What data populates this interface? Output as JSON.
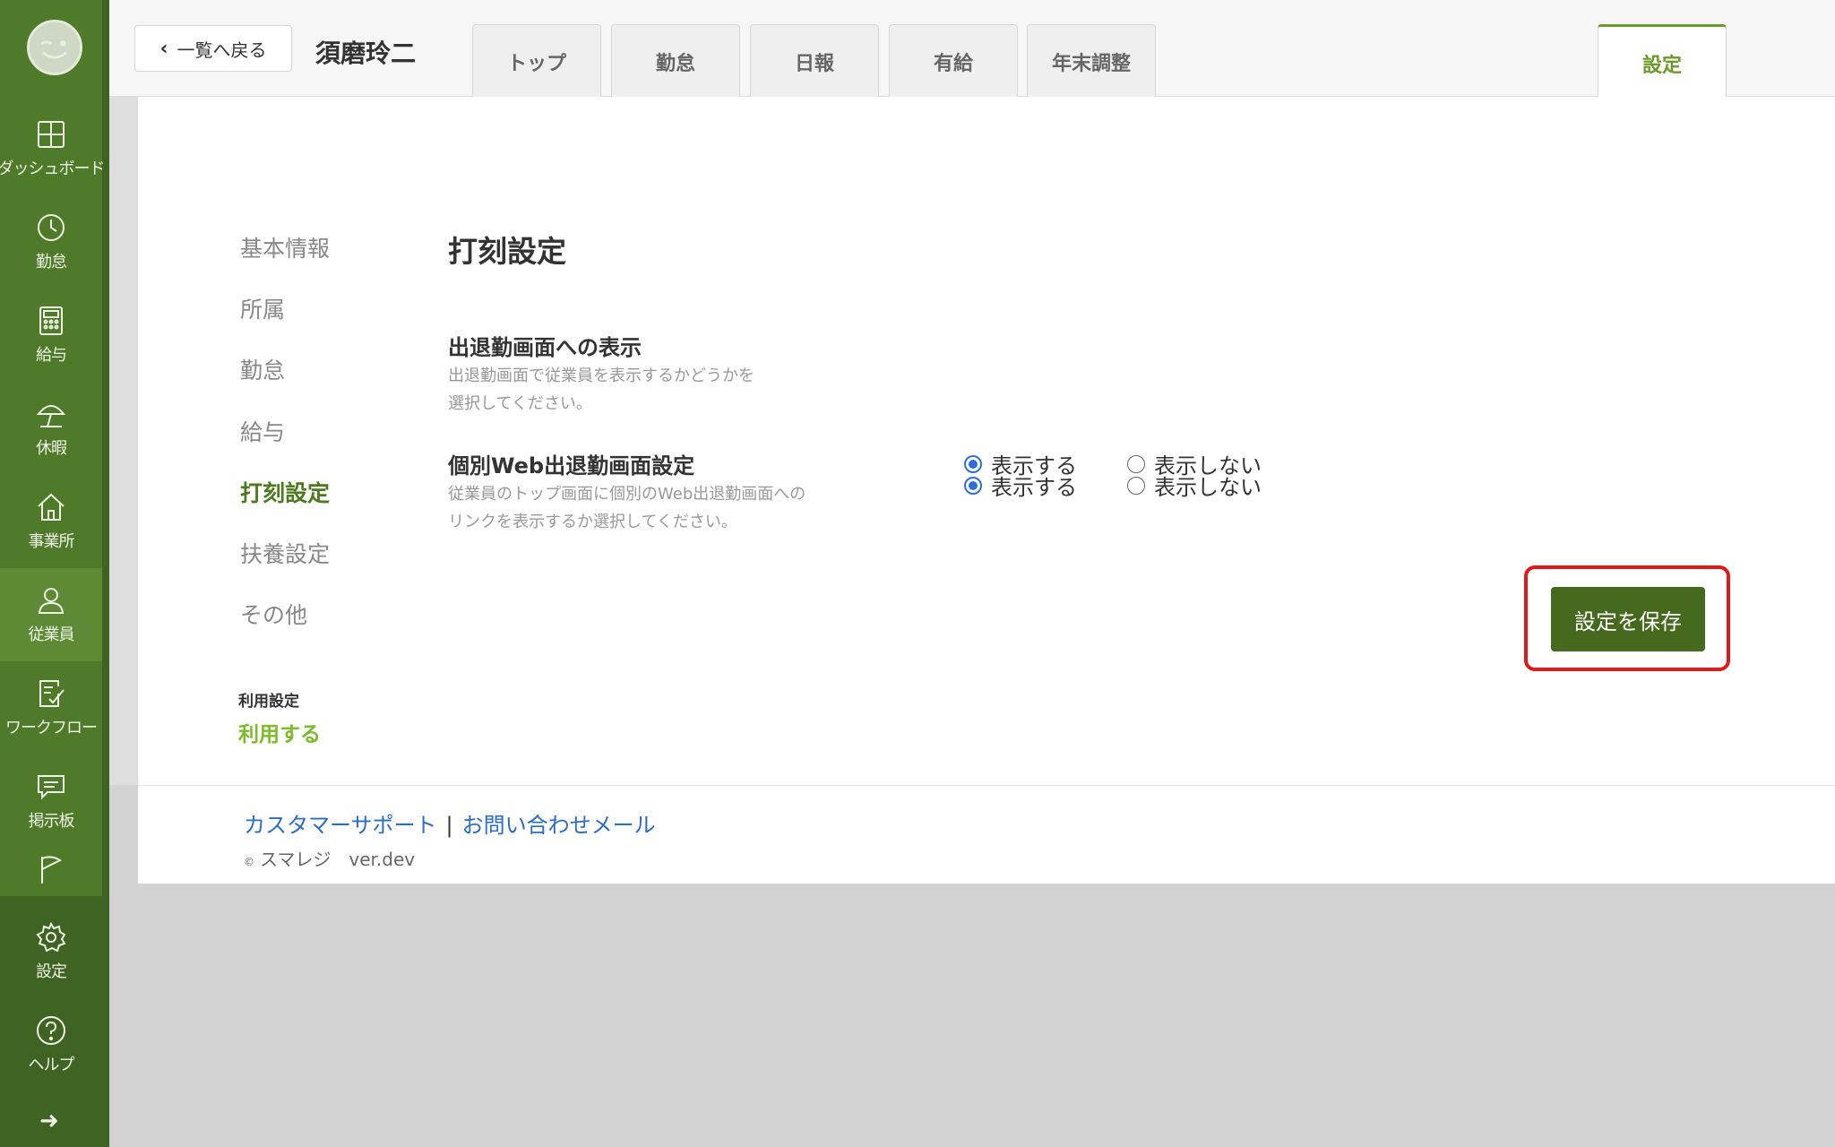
{
  "sidebar": {
    "items": [
      {
        "label": "ダッシュボード",
        "icon": "dashboard-icon"
      },
      {
        "label": "勤怠",
        "icon": "clock-icon"
      },
      {
        "label": "給与",
        "icon": "calculator-icon"
      },
      {
        "label": "休暇",
        "icon": "beach-umbrella-icon"
      },
      {
        "label": "事業所",
        "icon": "home-icon"
      },
      {
        "label": "従業員",
        "icon": "person-icon"
      },
      {
        "label": "ワークフロー",
        "icon": "checklist-icon"
      },
      {
        "label": "掲示板",
        "icon": "chat-bubble-icon"
      },
      {
        "label": "",
        "icon": "flag-icon"
      },
      {
        "label": "設定",
        "icon": "gear-icon"
      },
      {
        "label": "ヘルプ",
        "icon": "help-icon"
      }
    ],
    "active": "従業員",
    "expand_icon": "arrow-right-icon"
  },
  "header": {
    "back_label": "一覧へ戻る",
    "employee_name": "須磨玲二",
    "tabs": [
      "トップ",
      "勤怠",
      "日報",
      "有給",
      "年末調整"
    ],
    "active_tab": "設定"
  },
  "subnav": {
    "items": [
      "基本情報",
      "所属",
      "勤怠",
      "給与",
      "打刻設定",
      "扶養設定",
      "その他"
    ],
    "active": "打刻設定",
    "usage_label": "利用設定",
    "usage_value": "利用する"
  },
  "main": {
    "title": "打刻設定",
    "settings": [
      {
        "title": "出退勤画面への表示",
        "desc_lines": [
          "出退勤画面で従業員を表示するかどうかを",
          "選択してください。"
        ],
        "options": [
          "表示する",
          "表示しない"
        ],
        "selected": "表示する"
      },
      {
        "title": "個別Web出退勤画面設定",
        "desc_lines": [
          "従業員のトップ画面に個別のWeb出退勤画面への",
          "リンクを表示するか選択してください。"
        ],
        "options": [
          "表示する",
          "表示しない"
        ],
        "selected": "表示する"
      }
    ],
    "save_label": "設定を保存"
  },
  "footer": {
    "support_link": "カスタマーサポート",
    "separator": "|",
    "mail_link": "お問い合わせメール",
    "copyright_symbol": "©",
    "copyright": "スマレジ　ver.dev"
  },
  "colors": {
    "sidebar": "#4f7a2a",
    "accent": "#6b9a2a",
    "save_button": "#456a1e",
    "highlight": "#e11919",
    "link": "#2a6cc6",
    "radio": "#2f6fd6"
  }
}
